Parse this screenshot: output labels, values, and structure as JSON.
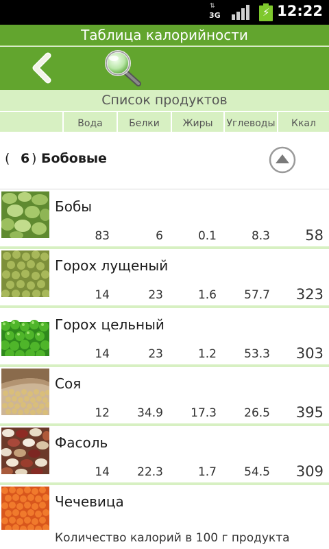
{
  "status_bar": {
    "network": "3G",
    "network_arrows": "⇅",
    "time": "12:22"
  },
  "app": {
    "title": "Таблица калорийности"
  },
  "toolbar": {
    "back_icon": "chevron-left-icon",
    "search_icon": "magnifier-icon"
  },
  "list": {
    "title": "Список продуктов",
    "columns": [
      "Вода",
      "Белки",
      "Жиры",
      "Углеводы",
      "Ккал"
    ]
  },
  "category": {
    "open_paren": "(",
    "count": "6",
    "close_paren": ")",
    "name": "Бобовые"
  },
  "products": [
    {
      "name": "Бобы",
      "water": "83",
      "protein": "6",
      "fat": "0.1",
      "carbs": "8.3",
      "kcal": "58"
    },
    {
      "name": "Горох лущеный",
      "water": "14",
      "protein": "23",
      "fat": "1.6",
      "carbs": "57.7",
      "kcal": "323"
    },
    {
      "name": "Горох цельный",
      "water": "14",
      "protein": "23",
      "fat": "1.2",
      "carbs": "53.3",
      "kcal": "303"
    },
    {
      "name": "Соя",
      "water": "12",
      "protein": "34.9",
      "fat": "17.3",
      "carbs": "26.5",
      "kcal": "395"
    },
    {
      "name": "Фасоль",
      "water": "14",
      "protein": "22.3",
      "fat": "1.7",
      "carbs": "54.5",
      "kcal": "309"
    },
    {
      "name": "Чечевица"
    }
  ],
  "footer": {
    "note": "Количество калорий в 100 г продукта"
  },
  "colors": {
    "primary_green": "#62a52e",
    "light_green": "#d7f0c2",
    "battery_green": "#7ec82d"
  }
}
